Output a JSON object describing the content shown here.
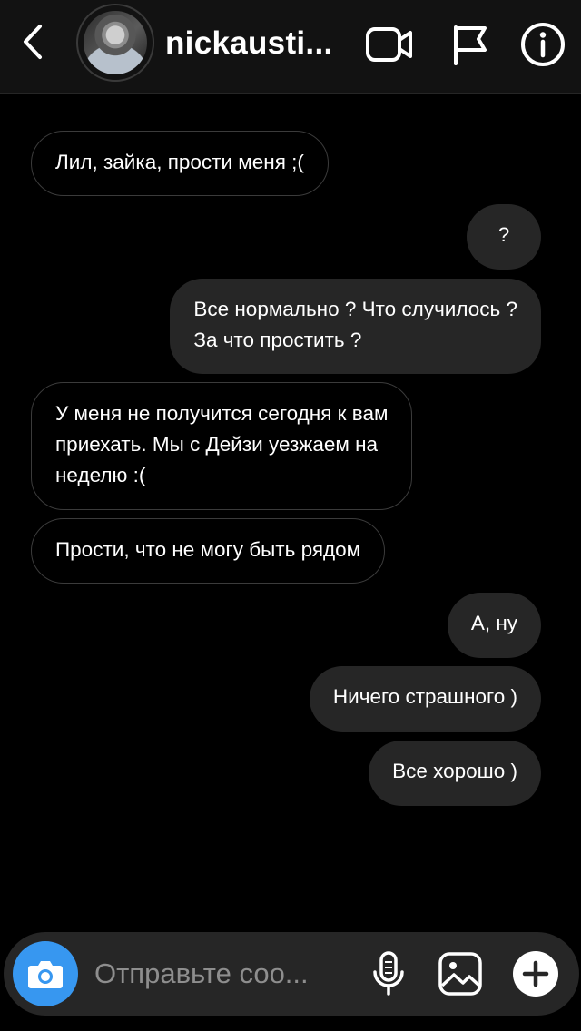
{
  "header": {
    "username": "nickausti...",
    "icons": {
      "back": "chevron-left-icon",
      "video": "video-camera-icon",
      "flag": "flag-icon",
      "info": "info-icon"
    }
  },
  "messages": [
    {
      "direction": "incoming",
      "text": "Лил, зайка, прости меня ;("
    },
    {
      "direction": "outgoing",
      "text": "?"
    },
    {
      "direction": "outgoing",
      "text": "Все нормально ? Что случилось ?\nЗа что простить ?"
    },
    {
      "direction": "incoming",
      "text": "У меня не получится сегодня к вам\nприехать. Мы с Дейзи уезжаем на\nнеделю :("
    },
    {
      "direction": "incoming",
      "text": "Прости, что не могу быть рядом"
    },
    {
      "direction": "outgoing",
      "text": "А, ну"
    },
    {
      "direction": "outgoing",
      "text": "Ничего страшного )"
    },
    {
      "direction": "outgoing",
      "text": "Все хорошо )"
    }
  ],
  "composer": {
    "placeholder": "Отправьте соо...",
    "value": "",
    "icons": {
      "camera": "camera-icon",
      "mic": "microphone-icon",
      "gallery": "image-gallery-icon",
      "plus": "plus-icon"
    }
  },
  "colors": {
    "background": "#000000",
    "header": "#121212",
    "outgoing_bubble": "#262626",
    "incoming_border": "#3b3b3b",
    "accent": "#3797f0",
    "placeholder": "#8e8e8e"
  }
}
